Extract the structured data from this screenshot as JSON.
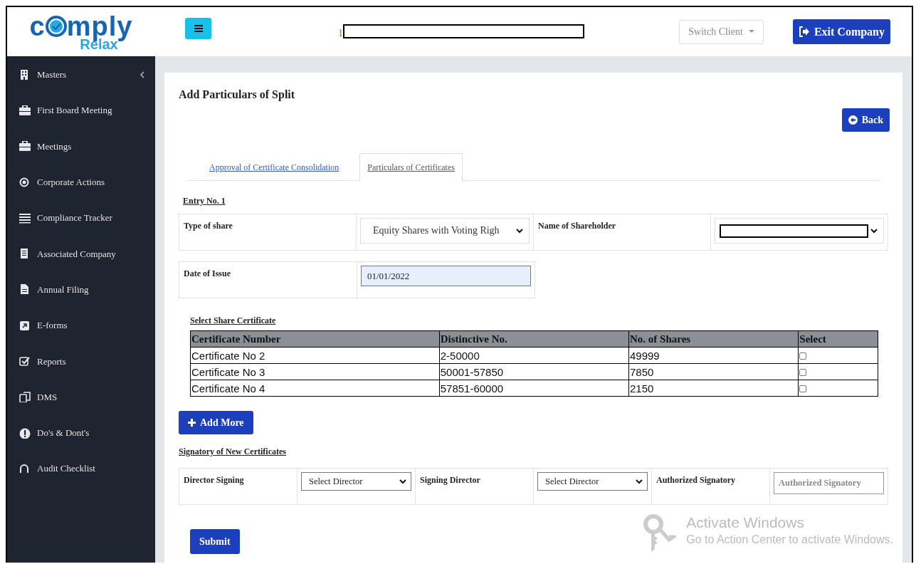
{
  "logo": {
    "prefix": "c",
    "suffix": "mply",
    "tagline": "Relax"
  },
  "header": {
    "counter": "1",
    "switch_client": "Switch Client",
    "exit_button": "Exit Company"
  },
  "sidebar": {
    "items": [
      {
        "label": "Masters",
        "expanded": false
      },
      {
        "label": "First Board Meeting"
      },
      {
        "label": "Meetings"
      },
      {
        "label": "Corporate Actions"
      },
      {
        "label": "Compliance Tracker"
      },
      {
        "label": "Associated Company"
      },
      {
        "label": "Annual Filing"
      },
      {
        "label": "E-forms"
      },
      {
        "label": "Reports"
      },
      {
        "label": "DMS"
      },
      {
        "label": "Do's & Dont's"
      },
      {
        "label": "Audit Checklist"
      }
    ]
  },
  "page": {
    "title": "Add Particulars of Split",
    "back_button": "Back",
    "tabs": [
      {
        "label": "Approval of Certificate Consolidation",
        "selected": false
      },
      {
        "label": "Particulars of Certificates",
        "selected": true
      }
    ],
    "entry_label": "Entry No. 1",
    "type_of_share": {
      "label": "Type of share",
      "value": "Equity Shares with Voting Righ"
    },
    "name_of_shareholder": {
      "label": "Name of Shareholder"
    },
    "date_of_issue": {
      "label": "Date of Issue",
      "value": "01/01/2022"
    },
    "certificates": {
      "title": "Select Share Certificate",
      "columns": [
        "Certificate Number",
        "Distinctive No.",
        "No. of Shares",
        "Select"
      ],
      "rows": [
        {
          "cells": [
            "Certificate No 2",
            "2-50000",
            "49999"
          ],
          "checked": false
        },
        {
          "cells": [
            "Certificate No 3",
            "50001-57850",
            "7850"
          ],
          "checked": false
        },
        {
          "cells": [
            "Certificate No 4",
            "57851-60000",
            "2150"
          ],
          "checked": false
        }
      ]
    },
    "add_more_button": "Add More",
    "signatory_title": "Signatory of New Certificates",
    "signatory_fields": [
      {
        "kind": "select",
        "label": "Director Signing",
        "value": "Select Director"
      },
      {
        "kind": "select",
        "label": "Signing Director",
        "value": "Select Director"
      },
      {
        "kind": "input",
        "label": "Authorized Signatory",
        "placeholder": "Authorized Signatory"
      }
    ],
    "submit_button": "Submit"
  },
  "os_notice": {
    "title": "Activate Windows",
    "message": "Go to Action Center to activate Windows."
  }
}
